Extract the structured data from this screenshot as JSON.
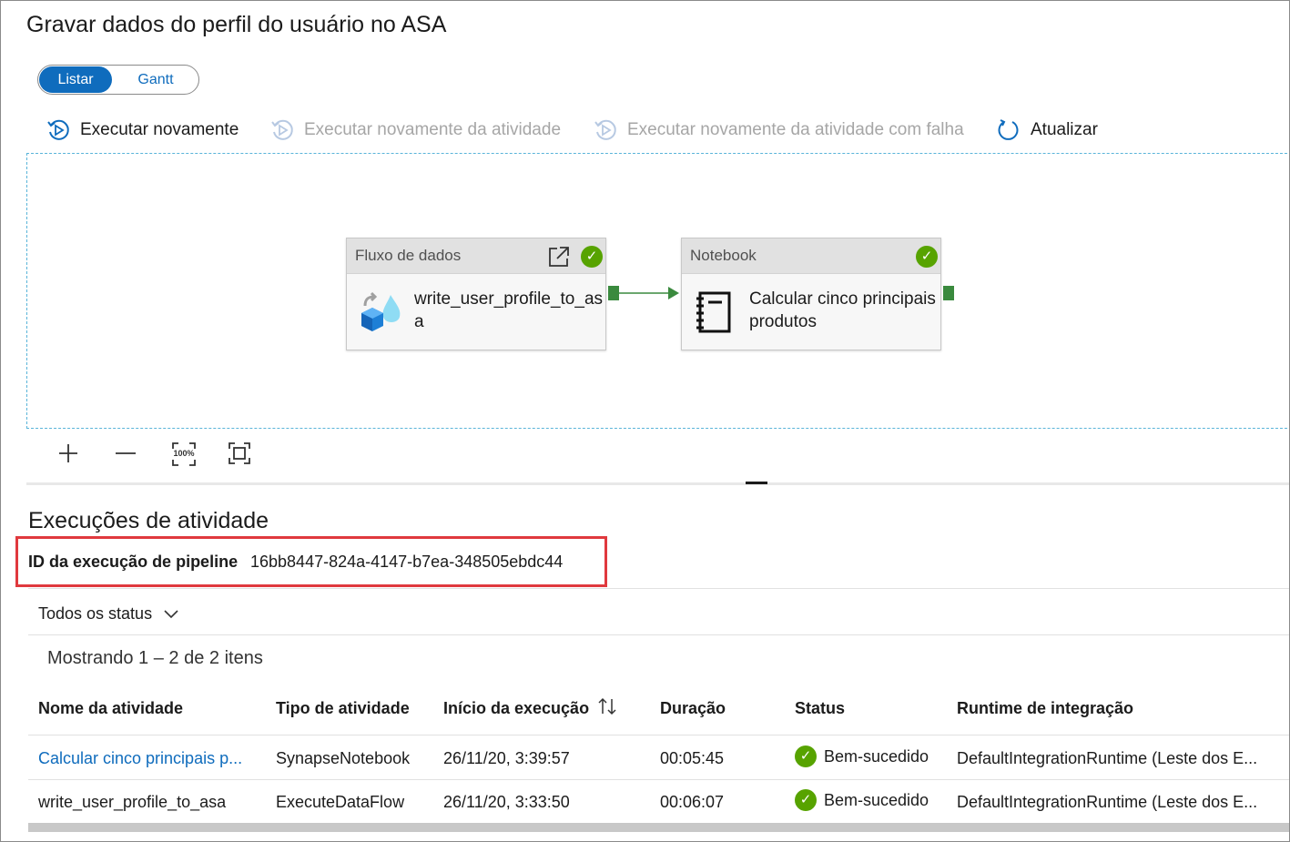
{
  "page": {
    "title": "Gravar dados do perfil do usuário no ASA"
  },
  "view_toggle": {
    "list": "Listar",
    "gantt": "Gantt"
  },
  "toolbar": {
    "rerun": "Executar novamente",
    "rerun_activity": "Executar novamente da atividade",
    "rerun_failed": "Executar novamente da atividade com falha",
    "refresh": "Atualizar"
  },
  "canvas": {
    "activities": [
      {
        "type": "Fluxo de dados",
        "name": "write_user_profile_to_asa",
        "icon": "dataflow-icon",
        "status": "success"
      },
      {
        "type": "Notebook",
        "name": "Calcular cinco principais produtos",
        "icon": "notebook-icon",
        "status": "success"
      }
    ],
    "zoom_controls": [
      "zoom-in-icon",
      "zoom-out-icon",
      "zoom-100-icon",
      "fit-to-screen-icon"
    ],
    "zoom_100_label": "100%"
  },
  "runs": {
    "title": "Execuções de atividade",
    "pipeline_run_label": "ID da execução de pipeline",
    "pipeline_run_id": "16bb8447-824a-4147-b7ea-348505ebdc44",
    "filter": "Todos os status",
    "showing": "Mostrando 1 – 2 de 2 itens",
    "columns": [
      "Nome da atividade",
      "Tipo de atividade",
      "Início da execução",
      "Duração",
      "Status",
      "Runtime de integração"
    ],
    "rows": [
      {
        "name": "Calcular cinco principais p...",
        "type": "SynapseNotebook",
        "start": "26/11/20, 3:39:57",
        "duration": "00:05:45",
        "status": "Bem-sucedido",
        "runtime": "DefaultIntegrationRuntime (Leste dos E..."
      },
      {
        "name": "write_user_profile_to_asa",
        "type": "ExecuteDataFlow",
        "start": "26/11/20, 3:33:50",
        "duration": "00:06:07",
        "status": "Bem-sucedido",
        "runtime": "DefaultIntegrationRuntime (Leste dos E..."
      }
    ]
  },
  "colors": {
    "accent": "#0f6cbd",
    "success": "#57a300",
    "highlight": "#e0393e",
    "canvas_border": "#59b4d9"
  }
}
